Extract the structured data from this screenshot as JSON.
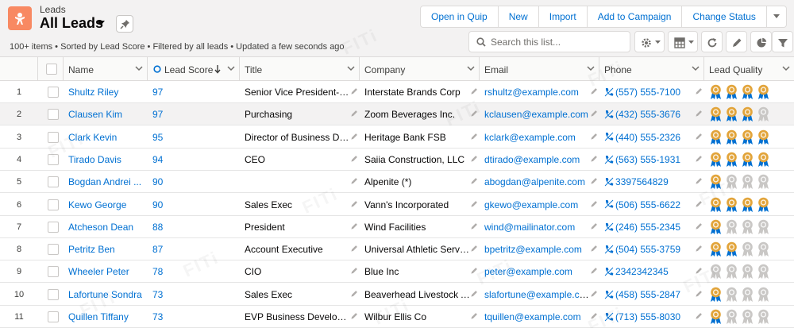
{
  "header": {
    "object_label": "Leads",
    "list_view_title": "All Leads",
    "meta": "100+ items • Sorted by Lead Score • Filtered by all leads • Updated a few seconds ago",
    "buttons": [
      "Open in Quip",
      "New",
      "Import",
      "Add to Campaign",
      "Change Status"
    ],
    "search_placeholder": "Search this list..."
  },
  "columns": {
    "name": "Name",
    "lead_score": "Lead Score",
    "title": "Title",
    "company": "Company",
    "email": "Email",
    "phone": "Phone",
    "lead_quality": "Lead Quality"
  },
  "rows": [
    {
      "n": "1",
      "name": "Shultz Riley",
      "score": "97",
      "title": "Senior Vice President-O...",
      "company": "Interstate Brands Corp",
      "email": "rshultz@example.com",
      "phone": "(557) 555-7100",
      "quality": 4
    },
    {
      "n": "2",
      "name": "Clausen Kim",
      "score": "97",
      "title": "Purchasing",
      "company": "Zoom Beverages Inc.",
      "email": "kclausen@example.com",
      "phone": "(432) 555-3676",
      "quality": 3
    },
    {
      "n": "3",
      "name": "Clark Kevin",
      "score": "95",
      "title": "Director of Business Dev...",
      "company": "Heritage Bank FSB",
      "email": "kclark@example.com",
      "phone": "(440) 555-2326",
      "quality": 4
    },
    {
      "n": "4",
      "name": "Tirado Davis",
      "score": "94",
      "title": "CEO",
      "company": "Saiia Construction, LLC",
      "email": "dtirado@example.com",
      "phone": "(563) 555-1931",
      "quality": 4
    },
    {
      "n": "5",
      "name": "Bogdan Andrei ...",
      "score": "90",
      "title": "",
      "company": "Alpenite (*)",
      "email": "abogdan@alpenite.com",
      "phone": "3397564829",
      "quality": 1
    },
    {
      "n": "6",
      "name": "Kewo George",
      "score": "90",
      "title": "Sales Exec",
      "company": "Vann's Incorporated",
      "email": "gkewo@example.com",
      "phone": "(506) 555-6622",
      "quality": 4
    },
    {
      "n": "7",
      "name": "Atcheson Dean",
      "score": "88",
      "title": "President",
      "company": "Wind Facilities",
      "email": "wind@mailinator.com",
      "phone": "(246) 555-2345",
      "quality": 1
    },
    {
      "n": "8",
      "name": "Petritz Ben",
      "score": "87",
      "title": "Account Executive",
      "company": "Universal Athletic Services",
      "email": "bpetritz@example.com",
      "phone": "(504) 555-3759",
      "quality": 2
    },
    {
      "n": "9",
      "name": "Wheeler Peter",
      "score": "78",
      "title": "CIO",
      "company": "Blue Inc",
      "email": "peter@example.com",
      "phone": "2342342345",
      "quality": 0
    },
    {
      "n": "10",
      "name": "Lafortune Sondra",
      "score": "73",
      "title": "Sales Exec",
      "company": "Beaverhead Livestock A...",
      "email": "slafortune@example.com",
      "phone": "(458) 555-2847",
      "quality": 1
    },
    {
      "n": "11",
      "name": "Quillen Tiffany",
      "score": "73",
      "title": "EVP Business Developm...",
      "company": "Wilbur Ellis Co",
      "email": "tquillen@example.com",
      "phone": "(713) 555-8030",
      "quality": 1
    }
  ],
  "colors": {
    "link": "#0070d2",
    "object_icon": "#f88962",
    "ribbon_active": "#e2a43a",
    "ribbon_inactive": "#c9c7c5"
  },
  "icons": {
    "object": "star-person-icon",
    "pin": "pin-icon",
    "search": "search-icon",
    "settings": "gear-icon",
    "table_view": "table-icon",
    "refresh": "refresh-icon",
    "edit": "pencil-icon",
    "chart": "pie-chart-icon",
    "filter": "filter-icon",
    "phone": "phone-icon",
    "quality": "award-ribbon-icon"
  },
  "watermark": "FITi"
}
